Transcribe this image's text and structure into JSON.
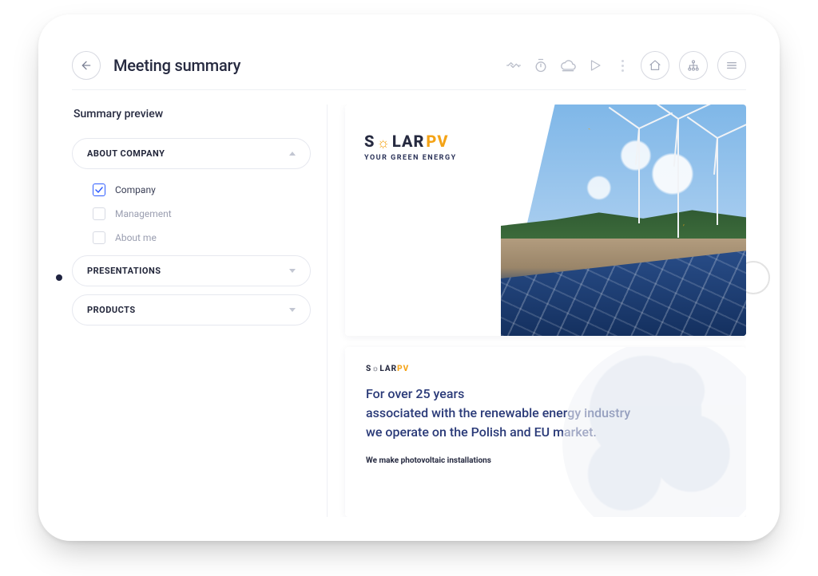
{
  "header": {
    "title": "Meeting summary"
  },
  "toolbar_icons": {
    "handshake": "handshake-icon",
    "timer": "timer-icon",
    "cloud": "cloud-upload-icon",
    "play": "play-icon",
    "home": "home-icon",
    "org": "org-chart-icon",
    "menu": "menu-icon"
  },
  "sidebar": {
    "panel_title": "Summary preview",
    "sections": [
      {
        "label": "ABOUT COMPANY",
        "expanded": true,
        "items": [
          {
            "label": "Company",
            "checked": true
          },
          {
            "label": "Management",
            "checked": false
          },
          {
            "label": "About me",
            "checked": false
          }
        ]
      },
      {
        "label": "PRESENTATIONS",
        "expanded": false
      },
      {
        "label": "PRODUCTS",
        "expanded": false
      }
    ]
  },
  "preview": {
    "slide1": {
      "brand_part1": "S",
      "brand_gear": "☼",
      "brand_part2": "LAR",
      "brand_part3": "PV",
      "brand_tagline": "YOUR GREEN ENERGY"
    },
    "slide2": {
      "mini_brand_a": "S☼LAR",
      "mini_brand_b": "PV",
      "lead_line1": "For over 25 years",
      "lead_line2": "associated with the renewable energy industry",
      "lead_line3": "we operate on the Polish and EU market.",
      "sub": "We make photovoltaic installations"
    }
  }
}
